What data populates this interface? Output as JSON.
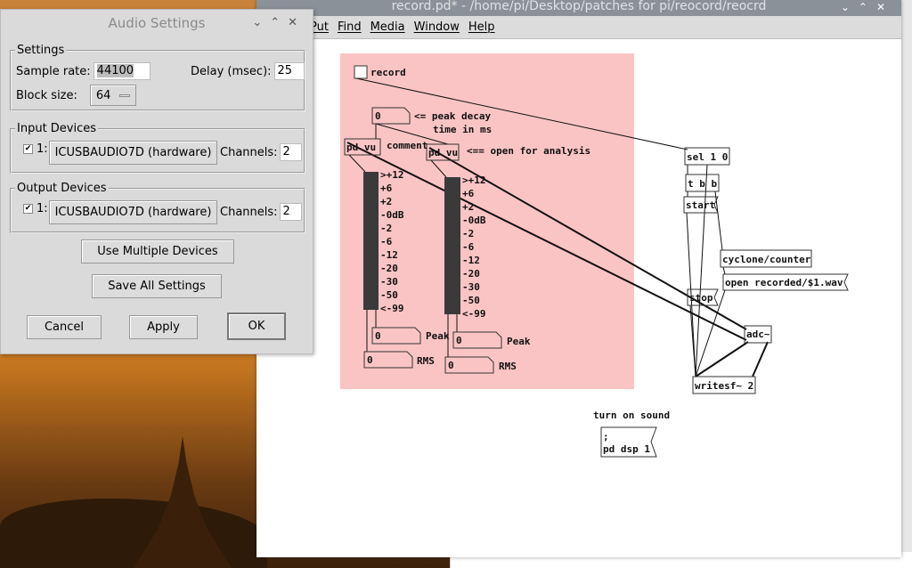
{
  "pd_window": {
    "title": "record.pd* - /home/pi/Desktop/patches for pi/reocord/reocrd",
    "menu": [
      "Put",
      "Find",
      "Media",
      "Window",
      "Help"
    ]
  },
  "patch": {
    "toggle_label": "record",
    "decay_number": "0",
    "decay_comment_1": "<= peak decay",
    "decay_comment_2": "time in ms",
    "pd_vu_1": "pd vu",
    "comment": "comment",
    "pd_vu_2": "pd vu",
    "analysis_comment": "<== open for analysis",
    "vu_scale": [
      ">+12",
      "+6",
      "+2",
      "-0dB",
      "-2",
      "-6",
      "-12",
      "-20",
      "-30",
      "-50",
      "<-99"
    ],
    "peak_1": "0",
    "peak_label": "Peak",
    "peak_2": "0",
    "rms_1": "0",
    "rms_label": "RMS",
    "rms_2": "0",
    "sel": "sel 1 0",
    "trigger": "t b b",
    "start_msg": "start",
    "counter": "cyclone/counter",
    "open_msg": "open recorded/$1.wav",
    "stop_msg": "stop",
    "adc": "adc~",
    "writesf": "writesf~ 2",
    "dsp_comment": "turn on sound",
    "dsp_msg_1": ";",
    "dsp_msg_2": "pd dsp 1",
    "bg_color": "#fbc4c4"
  },
  "dialog": {
    "title": "Audio Settings",
    "settings_legend": "Settings",
    "sample_rate_label": "Sample rate:",
    "sample_rate": "44100",
    "delay_label": "Delay (msec):",
    "delay": "25",
    "block_size_label": "Block size:",
    "block_size": "64",
    "input_legend": "Input Devices",
    "input_index": "1:",
    "input_device": "ICUSBAUDIO7D (hardware)",
    "input_channels_label": "Channels:",
    "input_channels": "2",
    "output_legend": "Output Devices",
    "output_index": "1:",
    "output_device": "ICUSBAUDIO7D (hardware)",
    "output_channels_label": "Channels:",
    "output_channels": "2",
    "multi_button": "Use Multiple Devices",
    "save_button": "Save All Settings",
    "cancel_button": "Cancel",
    "apply_button": "Apply",
    "ok_button": "OK"
  }
}
